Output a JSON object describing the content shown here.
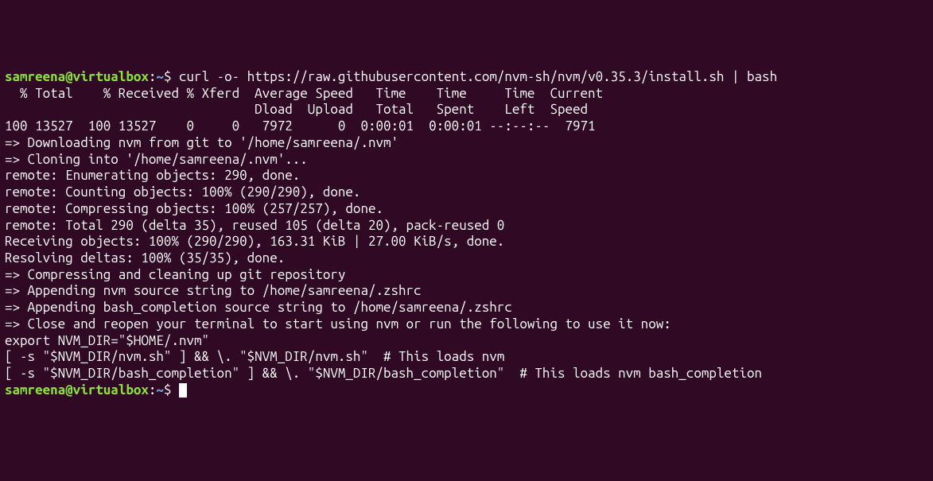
{
  "prompt": {
    "user_host": "samreena@virtualbox",
    "sep": ":",
    "path": "~",
    "dollar": "$",
    "command": "curl -o- https://raw.githubusercontent.com/nvm-sh/nvm/v0.35.3/install.sh | bash"
  },
  "lines": [
    "  % Total    % Received % Xferd  Average Speed   Time    Time     Time  Current",
    "                                 Dload  Upload   Total   Spent    Left  Speed",
    "100 13527  100 13527    0     0   7972      0  0:00:01  0:00:01 --:--:--  7971",
    "=> Downloading nvm from git to '/home/samreena/.nvm'",
    "=> Cloning into '/home/samreena/.nvm'...",
    "remote: Enumerating objects: 290, done.",
    "remote: Counting objects: 100% (290/290), done.",
    "remote: Compressing objects: 100% (257/257), done.",
    "remote: Total 290 (delta 35), reused 105 (delta 20), pack-reused 0",
    "Receiving objects: 100% (290/290), 163.31 KiB | 27.00 KiB/s, done.",
    "Resolving deltas: 100% (35/35), done.",
    "=> Compressing and cleaning up git repository",
    "",
    "=> Appending nvm source string to /home/samreena/.zshrc",
    "=> Appending bash_completion source string to /home/samreena/.zshrc",
    "=> Close and reopen your terminal to start using nvm or run the following to use it now:",
    "",
    "export NVM_DIR=\"$HOME/.nvm\"",
    "[ -s \"$NVM_DIR/nvm.sh\" ] && \\. \"$NVM_DIR/nvm.sh\"  # This loads nvm",
    "[ -s \"$NVM_DIR/bash_completion\" ] && \\. \"$NVM_DIR/bash_completion\"  # This loads nvm bash_completion"
  ],
  "prompt2": {
    "user_host": "samreena@virtualbox",
    "sep": ":",
    "path": "~",
    "dollar": "$"
  }
}
